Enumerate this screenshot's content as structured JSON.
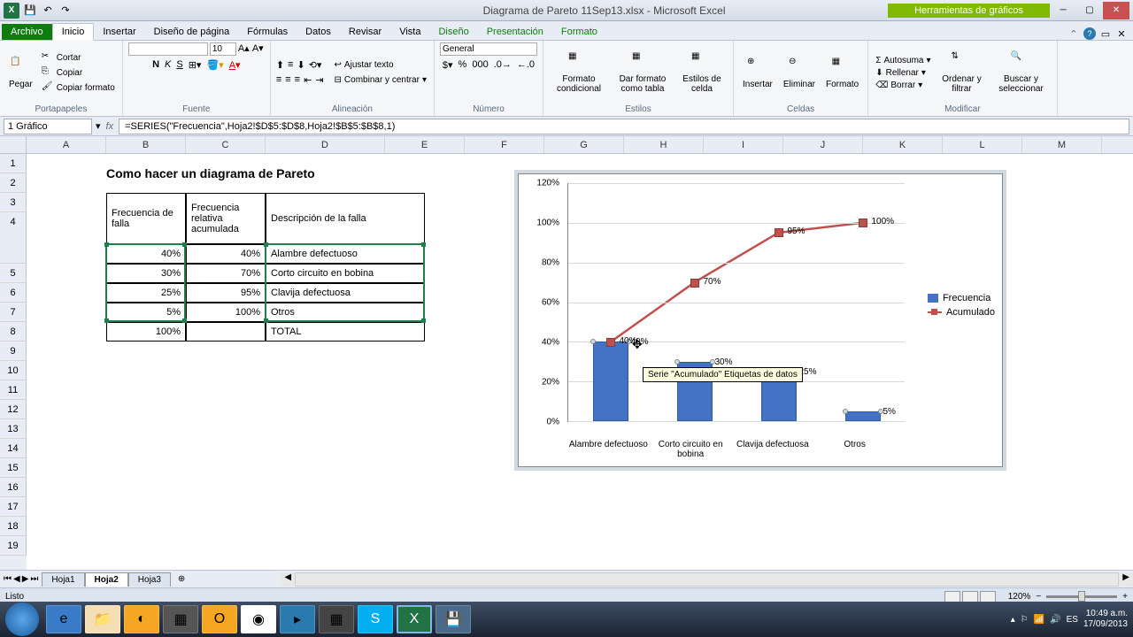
{
  "window": {
    "title": "Diagrama de Pareto 11Sep13.xlsx - Microsoft Excel",
    "contextual_tab": "Herramientas de gráficos"
  },
  "tabs": {
    "file": "Archivo",
    "items": [
      "Inicio",
      "Insertar",
      "Diseño de página",
      "Fórmulas",
      "Datos",
      "Revisar",
      "Vista",
      "Diseño",
      "Presentación",
      "Formato"
    ],
    "active": "Inicio"
  },
  "ribbon": {
    "clipboard": {
      "label": "Portapapeles",
      "paste": "Pegar",
      "cut": "Cortar",
      "copy": "Copiar",
      "format_painter": "Copiar formato"
    },
    "font": {
      "label": "Fuente",
      "family": "",
      "size": "10"
    },
    "alignment": {
      "label": "Alineación",
      "wrap": "Ajustar texto",
      "merge": "Combinar y centrar"
    },
    "number": {
      "label": "Número",
      "format": "General"
    },
    "styles": {
      "label": "Estilos",
      "cond": "Formato condicional",
      "table": "Dar formato como tabla",
      "cell": "Estilos de celda"
    },
    "cells": {
      "label": "Celdas",
      "insert": "Insertar",
      "delete": "Eliminar",
      "format": "Formato"
    },
    "editing": {
      "label": "Modificar",
      "autosum": "Autosuma",
      "fill": "Rellenar",
      "clear": "Borrar",
      "sort": "Ordenar y filtrar",
      "find": "Buscar y seleccionar"
    }
  },
  "formula_bar": {
    "name_box": "1 Gráfico",
    "formula": "=SERIES(\"Frecuencia\",Hoja2!$D$5:$D$8,Hoja2!$B$5:$B$8,1)"
  },
  "columns": [
    "A",
    "B",
    "C",
    "D",
    "E",
    "F",
    "G",
    "H",
    "I",
    "J",
    "K",
    "L",
    "M"
  ],
  "heading": "Como hacer un diagrama de Pareto",
  "table": {
    "headers": [
      "Frecuencia de falla",
      "Frecuencia relativa acumulada",
      "Descripción de la falla"
    ],
    "rows": [
      {
        "freq": "40%",
        "cum": "40%",
        "desc": "Alambre defectuoso"
      },
      {
        "freq": "30%",
        "cum": "70%",
        "desc": "Corto circuito en bobina"
      },
      {
        "freq": "25%",
        "cum": "95%",
        "desc": "Clavija defectuosa"
      },
      {
        "freq": "5%",
        "cum": "100%",
        "desc": "Otros"
      },
      {
        "freq": "100%",
        "cum": "",
        "desc": "TOTAL"
      }
    ]
  },
  "chart_data": {
    "type": "bar+line",
    "categories": [
      "Alambre defectuoso",
      "Corto circuito en bobina",
      "Clavija defectuosa",
      "Otros"
    ],
    "series": [
      {
        "name": "Frecuencia",
        "values": [
          40,
          30,
          25,
          5
        ],
        "type": "bar"
      },
      {
        "name": "Acumulado",
        "values": [
          40,
          70,
          95,
          100
        ],
        "type": "line"
      }
    ],
    "ylim": [
      0,
      120
    ],
    "y_ticks": [
      "0%",
      "20%",
      "40%",
      "60%",
      "80%",
      "100%",
      "120%"
    ],
    "data_labels_bar": [
      "40%",
      "30%",
      "25%",
      "5%"
    ],
    "data_labels_line": [
      "40%",
      "70%",
      "95%",
      "100%"
    ],
    "tooltip": "Serie \"Acumulado\" Etiquetas de datos"
  },
  "sheets": {
    "tabs": [
      "Hoja1",
      "Hoja2",
      "Hoja3"
    ],
    "active": "Hoja2"
  },
  "status": {
    "ready": "Listo",
    "zoom": "120%"
  },
  "taskbar": {
    "time": "10:49 a.m.",
    "date": "17/09/2013",
    "lang": "ES"
  }
}
